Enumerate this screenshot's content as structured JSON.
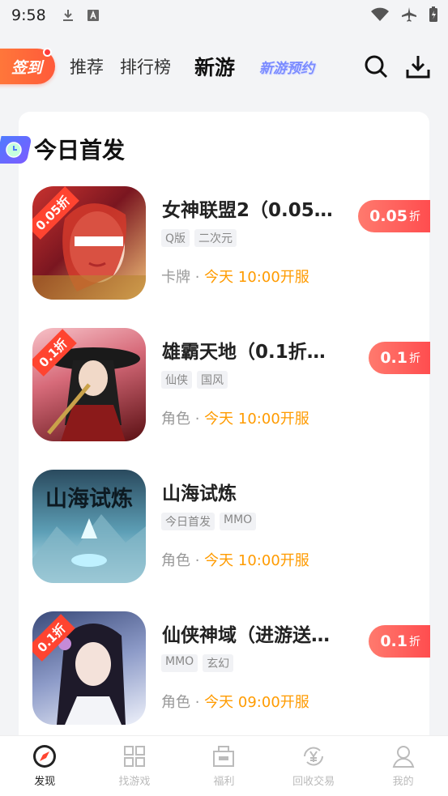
{
  "status": {
    "time": "9:58"
  },
  "nav": {
    "signin": "签到",
    "tabs": [
      "推荐",
      "排行榜",
      "新游",
      "新游预约"
    ],
    "active_index": 2
  },
  "section": {
    "title": "今日首发"
  },
  "games": [
    {
      "title": "女神联盟2（0.05…",
      "tags": [
        "Q版",
        "二次元"
      ],
      "genre": "卡牌",
      "time": "今天 10:00开服",
      "discount": "0.05",
      "discount_unit": "折",
      "corner": "0.05折",
      "icon_color1": "#c8322f",
      "icon_color2": "#f2c27a"
    },
    {
      "title": "雄霸天地（0.1折…",
      "tags": [
        "仙侠",
        "国风"
      ],
      "genre": "角色",
      "time": "今天 10:00开服",
      "discount": "0.1",
      "discount_unit": "折",
      "corner": "0.1折",
      "icon_color1": "#7a1a1a",
      "icon_color2": "#f0a8b0"
    },
    {
      "title": "山海试炼",
      "tags": [
        "今日首发",
        "MMO"
      ],
      "genre": "角色",
      "time": "今天 10:00开服",
      "discount": "",
      "discount_unit": "",
      "corner": "",
      "icon_title": "山海试炼",
      "icon_color1": "#2a4a5e",
      "icon_color2": "#9fd8e8"
    },
    {
      "title": "仙侠神域（进游送…",
      "tags": [
        "MMO",
        "玄幻"
      ],
      "genre": "角色",
      "time": "今天 09:00开服",
      "discount": "0.1",
      "discount_unit": "折",
      "corner": "0.1折",
      "icon_color1": "#4a5a8a",
      "icon_color2": "#dfe6f6"
    }
  ],
  "bottom": {
    "items": [
      "发现",
      "找游戏",
      "福利",
      "回收交易",
      "我的"
    ],
    "active_index": 0,
    "active_color": "#ff4430"
  }
}
